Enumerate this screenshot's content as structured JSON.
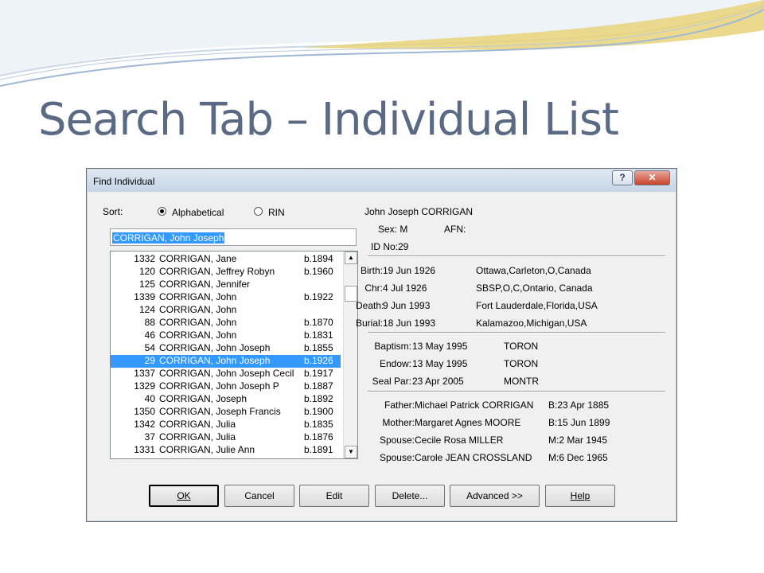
{
  "slide": {
    "title": "Search Tab – Individual List"
  },
  "dialog": {
    "title": "Find Individual",
    "help_btn": "?",
    "close_btn": "✕",
    "sort_label": "Sort:",
    "sort_alpha": "Alphabetical",
    "sort_rin": "RIN",
    "search_value": "CORRIGAN, John Joseph",
    "list": [
      {
        "rin": "1332",
        "name": "CORRIGAN, Jane",
        "birth": "b.1894"
      },
      {
        "rin": "120",
        "name": "CORRIGAN, Jeffrey Robyn",
        "birth": "b.1960"
      },
      {
        "rin": "125",
        "name": "CORRIGAN, Jennifer",
        "birth": ""
      },
      {
        "rin": "1339",
        "name": "CORRIGAN, John",
        "birth": "b.1922"
      },
      {
        "rin": "124",
        "name": "CORRIGAN, John",
        "birth": ""
      },
      {
        "rin": "88",
        "name": "CORRIGAN, John",
        "birth": "b.1870"
      },
      {
        "rin": "46",
        "name": "CORRIGAN, John",
        "birth": "b.1831"
      },
      {
        "rin": "54",
        "name": "CORRIGAN, John Joseph",
        "birth": "b.1855"
      },
      {
        "rin": "29",
        "name": "CORRIGAN, John Joseph",
        "birth": "b.1926",
        "selected": true
      },
      {
        "rin": "1337",
        "name": "CORRIGAN, John Joseph Cecil",
        "birth": "b.1917"
      },
      {
        "rin": "1329",
        "name": "CORRIGAN, John Joseph P",
        "birth": "b.1887"
      },
      {
        "rin": "40",
        "name": "CORRIGAN, Joseph",
        "birth": "b.1892"
      },
      {
        "rin": "1350",
        "name": "CORRIGAN, Joseph Francis",
        "birth": "b.1900"
      },
      {
        "rin": "1342",
        "name": "CORRIGAN, Julia",
        "birth": "b.1835"
      },
      {
        "rin": "37",
        "name": "CORRIGAN, Julia",
        "birth": "b.1876"
      },
      {
        "rin": "1331",
        "name": "CORRIGAN, Julie Ann",
        "birth": "b.1891"
      }
    ],
    "details": {
      "name": "John Joseph CORRIGAN",
      "sex": "Sex: M",
      "afn": "AFN:",
      "id": "ID No:29",
      "events": [
        {
          "label": "Birth:",
          "date": "19 Jun 1926",
          "place": "Ottawa,Carleton,O,Canada"
        },
        {
          "label": "Chr:",
          "date": "4 Jul 1926",
          "place": "SBSP,O,C,Ontario, Canada"
        },
        {
          "label": "Death:",
          "date": "9 Jun 1993",
          "place": "Fort Lauderdale,Florida,USA"
        },
        {
          "label": "Burial:",
          "date": "18 Jun 1993",
          "place": "Kalamazoo,Michigan,USA"
        }
      ],
      "ordinances": [
        {
          "label": "Baptism:",
          "date": "13 May 1995",
          "temple": "TORON"
        },
        {
          "label": "Endow:",
          "date": "13 May 1995",
          "temple": "TORON"
        },
        {
          "label": "Seal Par:",
          "date": "23 Apr 2005",
          "temple": "MONTR"
        }
      ],
      "family": [
        {
          "label": "Father:",
          "name": "Michael Patrick CORRIGAN",
          "date": "B:23 Apr 1885"
        },
        {
          "label": "Mother:",
          "name": "Margaret Agnes MOORE",
          "date": "B:15 Jun 1899"
        },
        {
          "label": "Spouse:",
          "name": "Cecile Rosa MILLER",
          "date": "M:2 Mar 1945"
        },
        {
          "label": "Spouse:",
          "name": "Carole JEAN CROSSLAND",
          "date": "M:6 Dec 1965"
        }
      ]
    },
    "buttons": {
      "ok": "OK",
      "cancel": "Cancel",
      "edit": "Edit",
      "delete": "Delete...",
      "advanced": "Advanced >>",
      "help": "Help"
    }
  },
  "colors": {
    "title": "#5a6a85",
    "selection": "#3399ff",
    "accent_gold": "#e8d27a",
    "accent_blue": "#9fb8d6"
  }
}
